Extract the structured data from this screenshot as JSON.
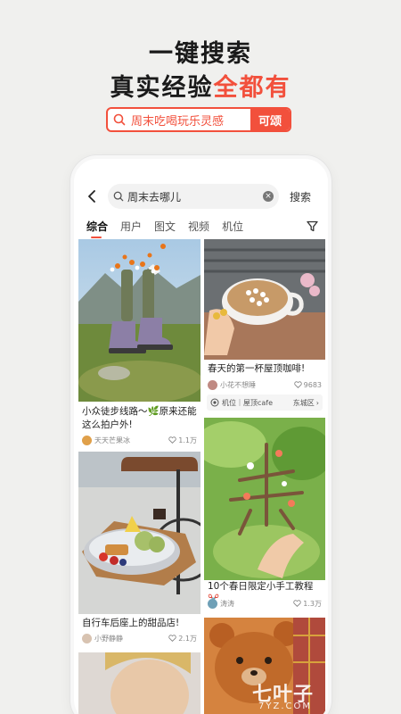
{
  "promo": {
    "headline1": "一键搜索",
    "headline2_prefix": "真实经验",
    "headline2_accent": "全都有",
    "search_text": "周末吃喝玩乐灵感",
    "search_button": "可颂",
    "accent_color": "#f2503c"
  },
  "search": {
    "query": "周末去哪儿",
    "button": "搜索"
  },
  "tabs": [
    "综合",
    "用户",
    "图文",
    "视频",
    "机位"
  ],
  "feed": {
    "left": [
      {
        "title": "小众徒步线路～🌿原来还能这么拍户外!",
        "author": "天天芒果冰",
        "likes": "1.1万"
      },
      {
        "title": "自行车后座上的甜品店!",
        "author": "小野静静",
        "likes": "2.1万"
      }
    ],
    "right": [
      {
        "title": "春天的第一杯屋顶咖啡!",
        "author": "小花不想睡",
        "likes": "9683",
        "location_label": "机位｜屋顶cafe",
        "location_area": "东城区"
      },
      {
        "title": "10个春日限定小手工教程✂️",
        "author": "涛涛",
        "likes": "1.3万"
      }
    ]
  },
  "watermark": {
    "brand": "七叶子",
    "sub": "7YZ.COM"
  }
}
